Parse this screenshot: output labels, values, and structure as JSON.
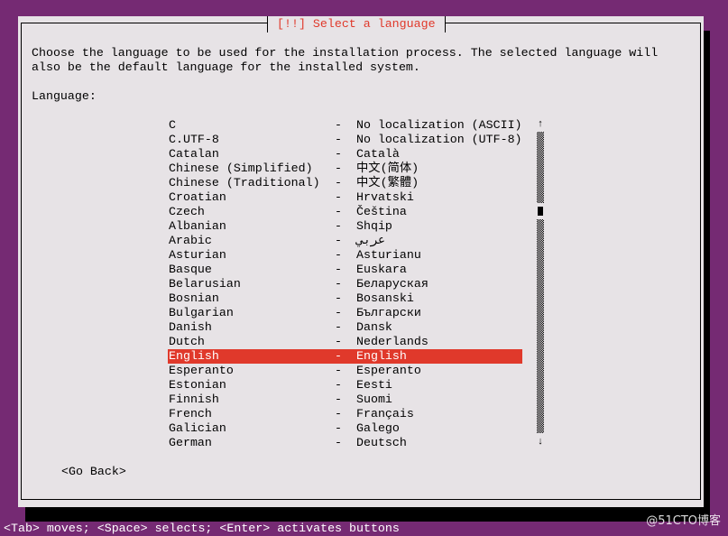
{
  "dialog": {
    "title": "[!!] Select a language",
    "description_line1": "Choose the language to be used for the installation process. The selected language will",
    "description_line2": "also be the default language for the installed system.",
    "list_label": "Language:",
    "separator": "-",
    "languages": [
      {
        "name": "C",
        "native": "No localization (ASCII)"
      },
      {
        "name": "C.UTF-8",
        "native": "No localization (UTF-8)"
      },
      {
        "name": "Catalan",
        "native": "Català"
      },
      {
        "name": "Chinese (Simplified)",
        "native": "中文(简体)"
      },
      {
        "name": "Chinese (Traditional)",
        "native": "中文(繁體)"
      },
      {
        "name": "Croatian",
        "native": "Hrvatski"
      },
      {
        "name": "Czech",
        "native": "Čeština"
      },
      {
        "name": "Albanian",
        "native": "Shqip"
      },
      {
        "name": "Arabic",
        "native": "عربي"
      },
      {
        "name": "Asturian",
        "native": "Asturianu"
      },
      {
        "name": "Basque",
        "native": "Euskara"
      },
      {
        "name": "Belarusian",
        "native": "Беларуская"
      },
      {
        "name": "Bosnian",
        "native": "Bosanski"
      },
      {
        "name": "Bulgarian",
        "native": "Български"
      },
      {
        "name": "Danish",
        "native": "Dansk"
      },
      {
        "name": "Dutch",
        "native": "Nederlands"
      },
      {
        "name": "English",
        "native": "English",
        "selected": true
      },
      {
        "name": "Esperanto",
        "native": "Esperanto"
      },
      {
        "name": "Estonian",
        "native": "Eesti"
      },
      {
        "name": "Finnish",
        "native": "Suomi"
      },
      {
        "name": "French",
        "native": "Français"
      },
      {
        "name": "Galician",
        "native": "Galego"
      },
      {
        "name": "German",
        "native": "Deutsch"
      }
    ],
    "go_back": "<Go Back>",
    "scroll_up": "↑",
    "scroll_down": "↓"
  },
  "status_bar": "<Tab> moves; <Space> selects; <Enter> activates buttons",
  "watermark": "@51CTO博客",
  "colors": {
    "background": "#752a73",
    "dialog": "#e7e3e6",
    "accent": "#e0392b"
  }
}
